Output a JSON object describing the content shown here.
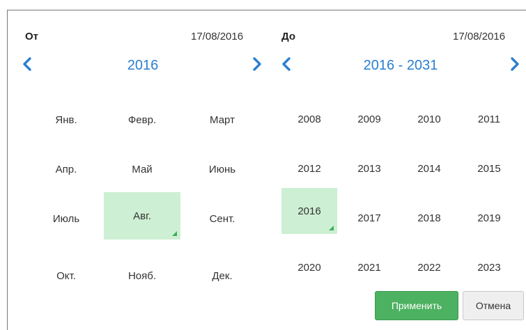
{
  "from": {
    "label": "От",
    "date": "17/08/2016",
    "period": "2016",
    "months": [
      "Янв.",
      "Февр.",
      "Март",
      "Апр.",
      "Май",
      "Июнь",
      "Июль",
      "Авг.",
      "Сент.",
      "Окт.",
      "Нояб.",
      "Дек."
    ],
    "selected": "Авг."
  },
  "to": {
    "label": "До",
    "date": "17/08/2016",
    "period": "2016 - 2031",
    "years": [
      "2008",
      "2009",
      "2010",
      "2011",
      "2012",
      "2013",
      "2014",
      "2015",
      "2016",
      "2017",
      "2018",
      "2019",
      "2020",
      "2021",
      "2022",
      "2023"
    ],
    "selected": "2016"
  },
  "buttons": {
    "apply": "Применить",
    "cancel": "Отмена"
  },
  "icons": {
    "prev": "chevron-left-icon",
    "next": "chevron-right-icon"
  },
  "colors": {
    "accent": "#2a7fd0",
    "selected_bg": "#cdefd3",
    "apply_bg": "#4cb160",
    "corner": "#3fae5b"
  }
}
